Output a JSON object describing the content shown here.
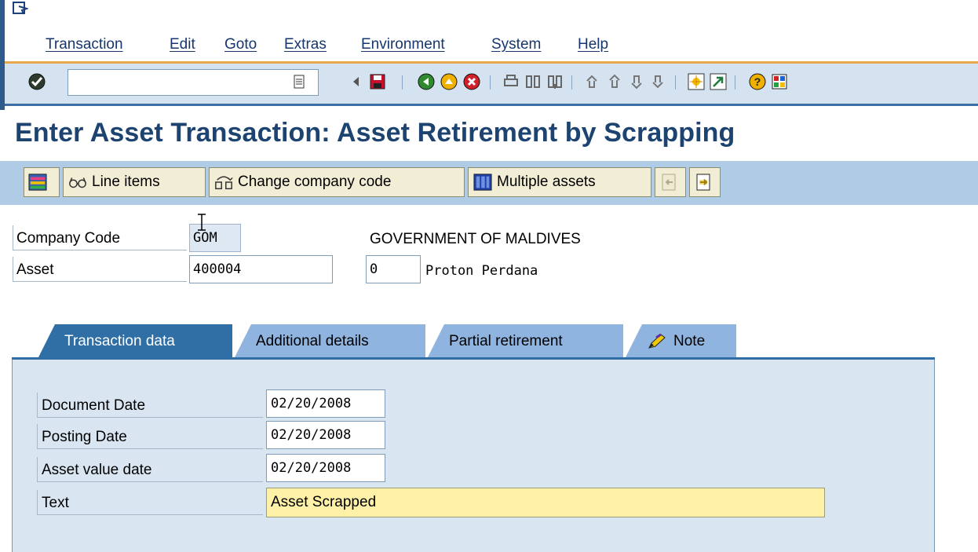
{
  "menu": {
    "items": [
      "Transaction",
      "Edit",
      "Goto",
      "Extras",
      "Environment",
      "System",
      "Help"
    ]
  },
  "toolbar": {
    "command_value": "",
    "icons": [
      "enter-icon",
      "history-dropdown-icon",
      "back-triangle-icon",
      "save-icon",
      "back-icon",
      "exit-icon",
      "cancel-icon",
      "print-icon",
      "find-icon",
      "find-next-icon",
      "first-page-icon",
      "previous-page-icon",
      "next-page-icon",
      "last-page-icon",
      "create-session-icon",
      "shortcut-icon",
      "help-icon",
      "layout-icon"
    ]
  },
  "title": "Enter Asset Transaction: Asset Retirement by Scrapping",
  "app_toolbar": {
    "line_items": "Line items",
    "change_company_code": "Change company code",
    "multiple_assets": "Multiple assets"
  },
  "header": {
    "company_code_label": "Company Code",
    "company_code_value": "GOM",
    "company_name": "GOVERNMENT OF MALDIVES",
    "asset_label": "Asset",
    "asset_value": "400004",
    "subnumber_value": "0",
    "asset_description": "Proton Perdana"
  },
  "tabs": [
    {
      "label": "Transaction data",
      "active": true
    },
    {
      "label": "Additional details",
      "active": false
    },
    {
      "label": "Partial retirement",
      "active": false
    },
    {
      "label": "Note",
      "active": false
    }
  ],
  "transaction_data": {
    "document_date_label": "Document Date",
    "document_date_value": "02/20/2008",
    "posting_date_label": "Posting Date",
    "posting_date_value": "02/20/2008",
    "asset_value_date_label": "Asset value date",
    "asset_value_date_value": "02/20/2008",
    "text_label": "Text",
    "text_value": "Asset Scrapped"
  },
  "colors": {
    "title": "#1d4470",
    "toolbar_bg": "#d5e3f1",
    "app_toolbar_bg": "#afcbe6",
    "active_tab": "#2f6fa6",
    "inactive_tab": "#8fb4df",
    "text_field_bg": "#fff2a8",
    "menu_underline": "#e9a84e"
  }
}
